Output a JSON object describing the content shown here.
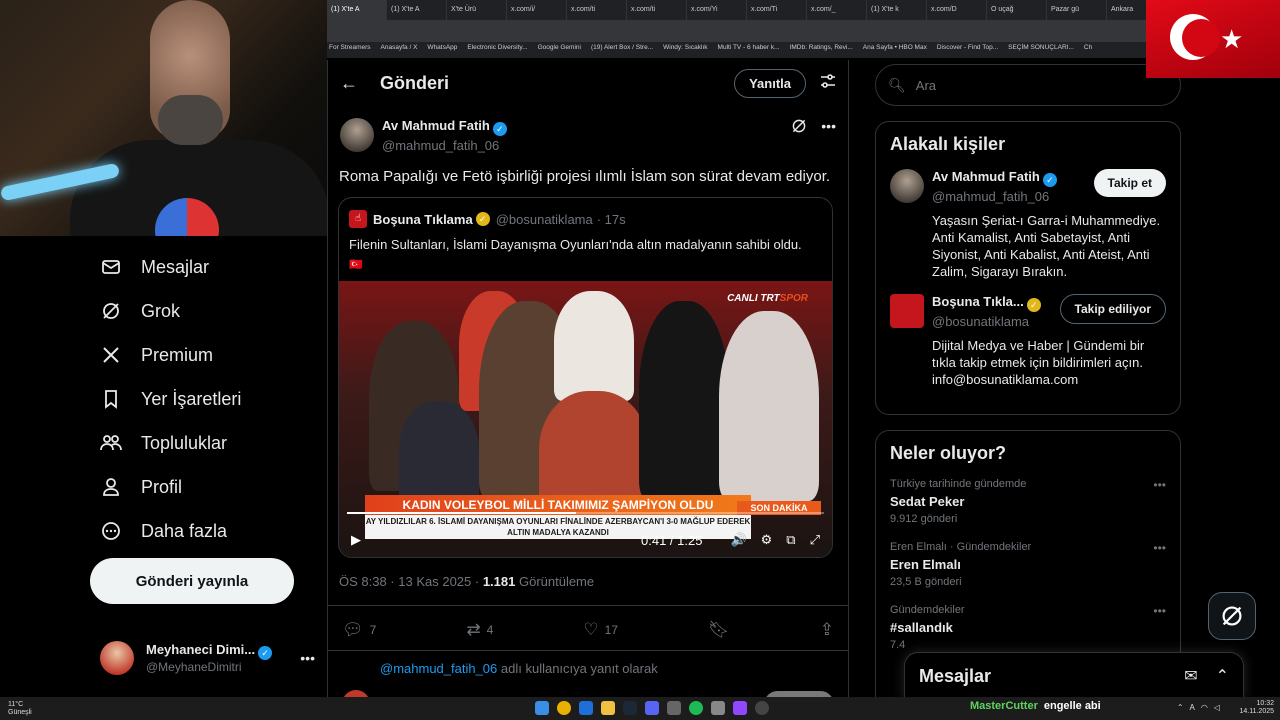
{
  "browser": {
    "tabs": [
      "(1) X'te A",
      "(1) X'te A",
      "X'te Ürü",
      "x.com/i/",
      "x.com/ti",
      "x.com/ti",
      "x.com/Yi",
      "x.com/Ti",
      "x.com/_",
      "(1) X'te k",
      "x.com/D",
      "O uçağ",
      "Pazar gü",
      "Ankara"
    ],
    "bookmarks": [
      "For Streamers",
      "Anasayfa / X",
      "WhatsApp",
      "Electronic Diversity...",
      "Google Gemini",
      "(19) Alert Box / Stre...",
      "Windy: Sıcaklık",
      "Multi TV - 6 haber k...",
      "IMDb: Ratings, Revi...",
      "Ana Sayfa • HBO Max",
      "Discover - Find Top...",
      "SEÇİM SONUÇLARI...",
      "Ch"
    ]
  },
  "sidebar": {
    "items": [
      {
        "label": "Mesajlar",
        "icon": "mail-icon"
      },
      {
        "label": "Grok",
        "icon": "grok-icon"
      },
      {
        "label": "Premium",
        "icon": "x-logo-icon"
      },
      {
        "label": "Yer İşaretleri",
        "icon": "bookmark-icon"
      },
      {
        "label": "Topluluklar",
        "icon": "communities-icon"
      },
      {
        "label": "Profil",
        "icon": "profile-icon"
      },
      {
        "label": "Daha fazla",
        "icon": "more-circle-icon"
      }
    ],
    "post_button": "Gönderi yayınla",
    "account": {
      "name": "Meyhaneci Dimi...",
      "handle": "@MeyhaneDimitri"
    }
  },
  "main": {
    "header_title": "Gönderi",
    "reply_button": "Yanıtla",
    "post": {
      "author_name": "Av Mahmud Fatih",
      "author_handle": "@mahmud_fatih_06",
      "text": "Roma Papalığı ve Fetö işbirliği projesi ılımlı İslam son sürat devam ediyor.",
      "quote": {
        "name": "Boşuna Tıklama",
        "handle": "@bosunatiklama",
        "time": "· 17s",
        "text": "Filenin Sultanları, İslami Dayanışma Oyunları'nda altın madalyanın sahibi oldu.",
        "flag": "🇹🇷",
        "video": {
          "channel_prefix": "CANLI TRT",
          "channel_suffix": "SPOR",
          "banner": "KADIN VOLEYBOL MİLLİ TAKIMIMIZ ŞAMPİYON OLDU",
          "banner_tag": "SON DAKİKA",
          "subline1": "AY YILDIZLILAR 6. İSLAMİ DAYANIŞMA OYUNLARI FİNALİNDE AZERBAYCAN'I 3-0 MAĞLUP EDEREK",
          "subline2": "ALTIN MADALYA KAZANDI",
          "time": "0:41 / 1:25",
          "progress": 0.48
        }
      },
      "timestamp": "ÖS 8:38 · 13 Kas 2025 · ",
      "views_count": "1.181",
      "views_label": " Görüntüleme",
      "replies": "7",
      "reposts": "4",
      "likes": "17"
    },
    "replying_prefix": "@mahmud_fatih_06",
    "replying_suffix": " adlı kullanıcıya yanıt olarak",
    "composer_reply": "Yanıtla"
  },
  "right": {
    "search_placeholder": "Ara",
    "related_title": "Alakalı kişiler",
    "people": [
      {
        "name": "Av Mahmud Fatih",
        "handle": "@mahmud_fatih_06",
        "button": "Takip et",
        "bio": "Yaşasın Şeriat-ı Garra-i Muhammediye. Anti Kamalist, Anti Sabetayist, Anti Siyonist, Anti Kabalist, Anti Ateist, Anti Zalim, Sigarayı Bırakın."
      },
      {
        "name": "Boşuna Tıkla...",
        "handle": "@bosunatiklama",
        "button": "Takip ediliyor",
        "bio": "Dijital Medya ve Haber | Gündemi bir tıkla takip etmek için bildirimleri açın. info@bosunatiklama.com"
      }
    ],
    "trends_title": "Neler oluyor?",
    "trends": [
      {
        "context": "Türkiye tarihinde gündemde",
        "name": "Sedat Peker",
        "count": "9.912 gönderi"
      },
      {
        "context": "Eren Elmalı · Gündemdekiler",
        "name": "Eren Elmalı",
        "count": "23,5 B gönderi"
      },
      {
        "context": "Gündemdekiler",
        "name": "#sallandık",
        "count": "7.4"
      }
    ]
  },
  "drawer": {
    "title": "Mesajlar"
  },
  "taskbar": {
    "weather_temp": "11°C",
    "weather_desc": "Güneşli",
    "chat_user": "MasterCutter",
    "chat_text": "engelle abi",
    "time": "10:32",
    "date": "14.11.2025"
  },
  "colors": {
    "accent": "#1d9bf0",
    "verified_gold": "#e2b719",
    "background": "#000000"
  }
}
